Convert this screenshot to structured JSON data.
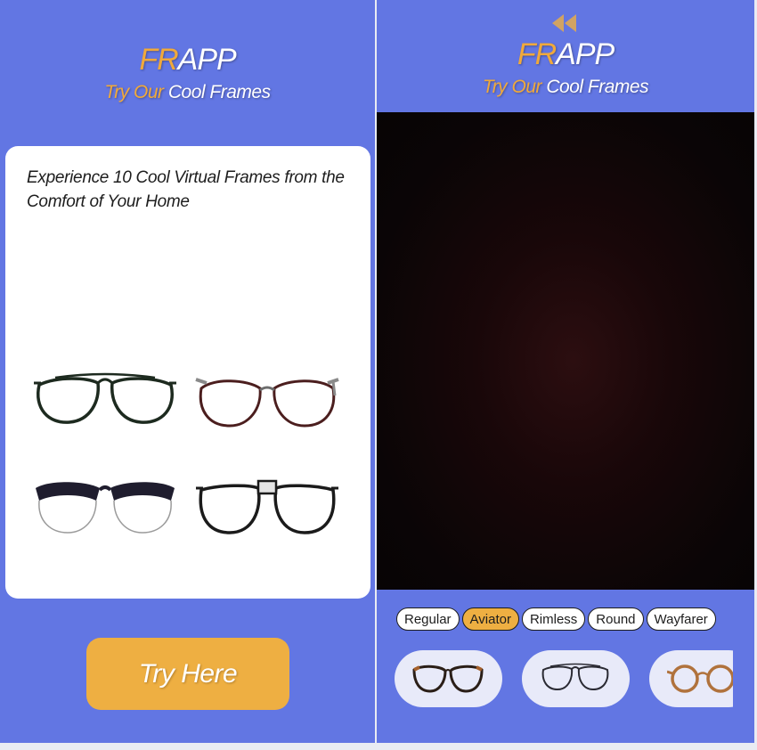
{
  "left_screen": {
    "brand": {
      "accent": "FR",
      "rest": "APP"
    },
    "tagline": {
      "accent": "Try Our",
      "rest": "Cool Frames"
    },
    "card": {
      "text": "Experience 10 Cool Virtual Frames from the Comfort of Your Home",
      "frames": [
        "aviator-frame",
        "cat-eye-frame",
        "browline-frame",
        "square-aviator-frame"
      ]
    },
    "try_button_label": "Try Here"
  },
  "right_screen": {
    "back_icon": "rewind-icon",
    "brand": {
      "accent": "FR",
      "rest": "APP"
    },
    "tagline": {
      "accent": "Try Our",
      "rest": "Cool Frames"
    },
    "categories": [
      {
        "label": "Regular",
        "active": false
      },
      {
        "label": "Aviator",
        "active": true
      },
      {
        "label": "Rimless",
        "active": false
      },
      {
        "label": "Round",
        "active": false
      },
      {
        "label": "Wayfarer",
        "active": false
      }
    ],
    "thumbnails": [
      "tortoise-cat-eye-frame",
      "aviator-frame",
      "tortoise-round-frame"
    ]
  },
  "colors": {
    "background": "#6276e3",
    "accent": "#eeaf42",
    "card": "#ffffff",
    "thumb_bg": "#e8eaf9"
  }
}
